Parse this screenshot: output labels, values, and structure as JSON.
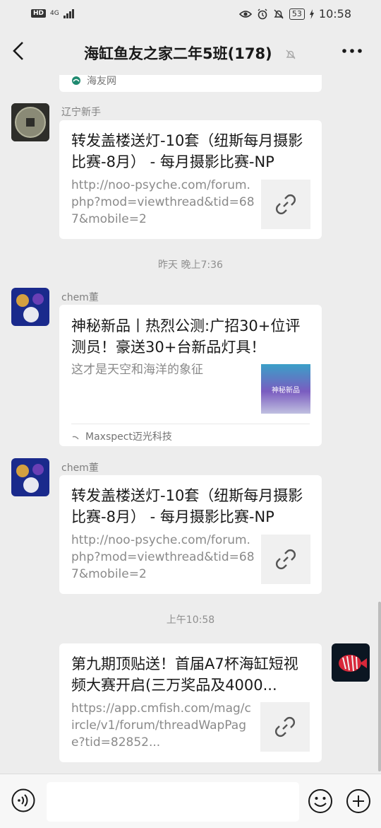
{
  "status_bar": {
    "hd": "HD",
    "network": "4G",
    "network_sub": "46",
    "battery": "53",
    "time": "10:58"
  },
  "header": {
    "title": "海缸鱼友之家二年5班(178)"
  },
  "messages": [
    {
      "source": "海友网"
    },
    {
      "sender": "辽宁新手",
      "title": "转发盖楼送灯-10套（纽斯每月摄影比赛-8月） - 每月摄影比赛-NP",
      "desc": "http://noo-psyche.com/forum.php?mod=viewthread&tid=687&mobile=2"
    },
    {
      "timestamp": "昨天 晚上7:36"
    },
    {
      "sender": "chem董",
      "title": "神秘新品丨热烈公测:广招30+位评测员！豪送30+台新品灯具！",
      "desc": "这才是天空和海洋的象征",
      "thumb_text": "神秘新品",
      "source": "Maxspect迈光科技"
    },
    {
      "sender": "chem董",
      "title": "转发盖楼送灯-10套（纽斯每月摄影比赛-8月） - 每月摄影比赛-NP",
      "desc": "http://noo-psyche.com/forum.php?mod=viewthread&tid=687&mobile=2"
    },
    {
      "timestamp": "上午10:58"
    },
    {
      "title": "第九期顶贴送！首届A7杯海缸短视频大赛开启(三万奖品及4000...",
      "desc": "https://app.cmfish.com/mag/circle/v1/forum/threadWapPage?tid=82852..."
    }
  ],
  "colors": {
    "background": "#ededed",
    "card": "#ffffff",
    "text": "#191919",
    "muted": "#8a8a8a"
  },
  "icons": [
    "back-icon",
    "mute-icon",
    "more-icon",
    "link-icon",
    "voice-icon",
    "emoji-icon",
    "plus-icon"
  ]
}
